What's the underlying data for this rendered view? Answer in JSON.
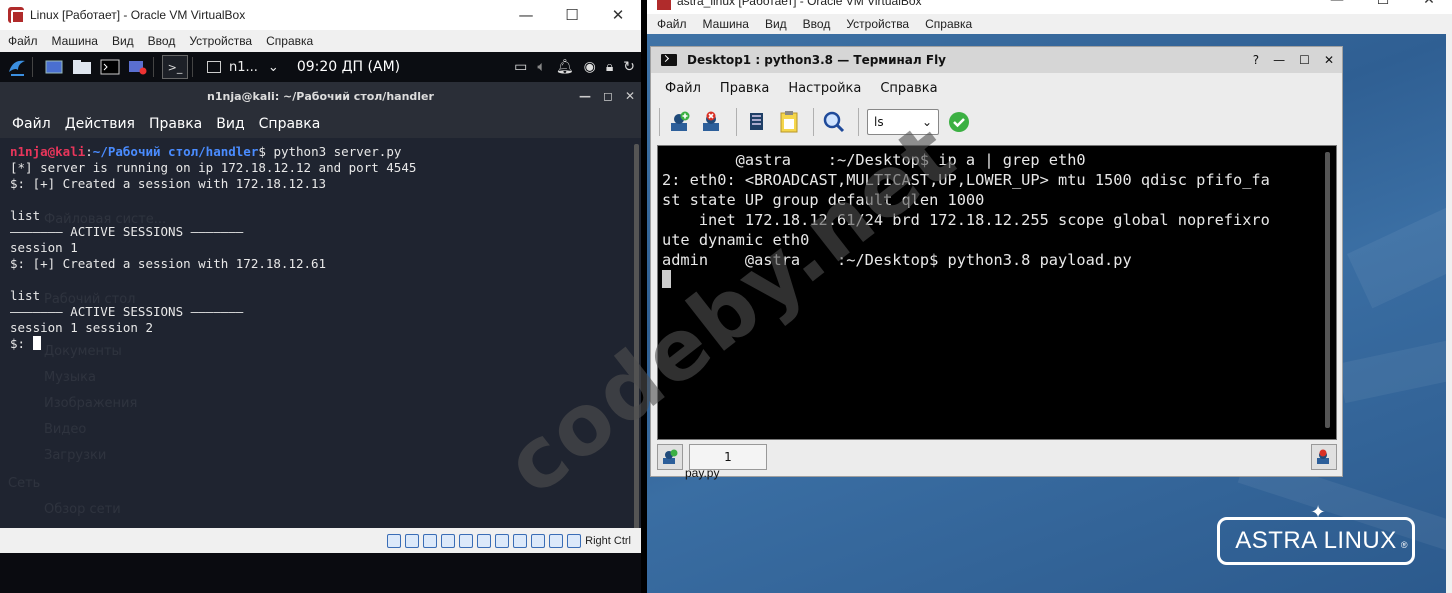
{
  "left_vm": {
    "window_title": "Linux [Работает] - Oracle VM VirtualBox",
    "menu": [
      "Файл",
      "Машина",
      "Вид",
      "Ввод",
      "Устройства",
      "Справка"
    ],
    "panel": {
      "task_label": "n1...",
      "clock": "09:20 ДП (AM)"
    },
    "terminal": {
      "title": "n1nja@kali: ~/Рабочий стол/handler",
      "menu": [
        "Файл",
        "Действия",
        "Правка",
        "Вид",
        "Справка"
      ],
      "prompt_user": "n1nja@kali",
      "prompt_path": "~/Рабочий стол/handler",
      "command": "python3 server.py",
      "lines": [
        "[*] server is running on ip 172.18.12.12 and port 4545",
        "$: [+] Created a session with 172.18.12.13",
        "",
        "list",
        "——————— ACTIVE SESSIONS ———————",
        "session 1",
        "$: [+] Created a session with 172.18.12.61",
        "",
        "list",
        "——————— ACTIVE SESSIONS ———————",
        "session 1 session 2"
      ],
      "last_prompt": "$: "
    },
    "ghost_items": [
      "Файловая систе...",
      "Рабочий стол",
      "Документы",
      "Музыка",
      "Изображения",
      "Видео",
      "Загрузки",
      "Сеть",
      "Обзор сети"
    ],
    "status_right": "Right Ctrl"
  },
  "right_vm": {
    "window_title": "astra_linux [Работает] - Oracle VM VirtualBox",
    "menu": [
      "Файл",
      "Машина",
      "Вид",
      "Ввод",
      "Устройства",
      "Справка"
    ],
    "fly": {
      "title": "Desktop1 : python3.8 — Терминал Fly",
      "menu": [
        "Файл",
        "Правка",
        "Настройка",
        "Справка"
      ],
      "select_value": "ls",
      "lines": [
        "        @astra    :~/Desktop$ ip a | grep eth0",
        "2: eth0: <BROADCAST,MULTICAST,UP,LOWER_UP> mtu 1500 qdisc pfifo_fa",
        "st state UP group default qlen 1000",
        "    inet 172.18.12.61/24 brd 172.18.12.255 scope global noprefixro",
        "ute dynamic eth0",
        "admin    @astra    :~/Desktop$ python3.8 payload.py"
      ],
      "tab_label": "1"
    },
    "desktop_label": "pay.py",
    "logo_text": "ASTRA LINUX",
    "logo_reg": "®"
  },
  "watermark": "codeby.net",
  "colors": {
    "kali_bg": "#1f2430",
    "kali_user": "#e8365b",
    "kali_path": "#4a8cff",
    "astra_bg": "#3a6ea3",
    "ok_green": "#3cb043"
  }
}
